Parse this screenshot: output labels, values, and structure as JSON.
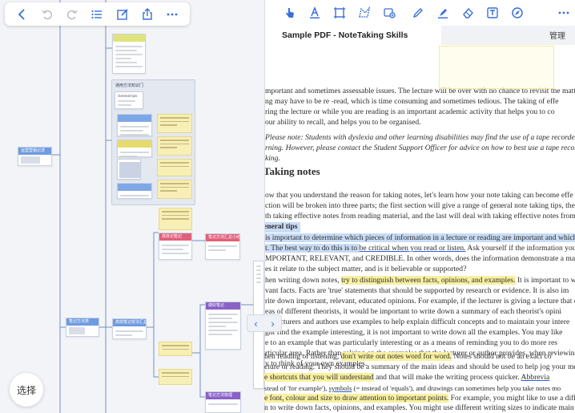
{
  "left_toolbar": {
    "buttons": [
      "back-icon",
      "undo-icon",
      "redo-icon",
      "list-icon",
      "edit-icon",
      "share-icon",
      "more-icon"
    ]
  },
  "canvas": {
    "nodes": {
      "root": "运营营销记述",
      "group_title": "通用方法知识门",
      "group_sub": "General tips",
      "middle_a": "笔记方法类",
      "middle_b": "高效笔记技法汇总",
      "pink_a": "高效记笔记",
      "pink_b": "笔记方法汇总小结",
      "purple_a": "做好笔记",
      "purple_b": "笔记方法梳理"
    }
  },
  "select_button": "选择",
  "viewer": {
    "tools": [
      "pointer-icon",
      "text-style-icon",
      "frame-icon",
      "lasso-icon",
      "image-icon",
      "pen-icon",
      "highlighter-icon",
      "eraser-icon",
      "textbox-icon",
      "compass-icon",
      "more-icon"
    ],
    "tab_title": "Sample PDF - NoteTaking Skills",
    "manage_label": "管理",
    "document": {
      "p1": [
        "mportant and sometimes assessable issues. The lecture will be over with no chance to revisit the matter",
        "ng may have to be re -read, which is time consuming and sometimes tedious. The taking of effe",
        "ring the lecture or while you are reading is an important academic activity that helps you to co",
        "our ability to recall, and helps you to be organised."
      ],
      "p2": [
        "Please note: Students with dyslexia and other learning disabilities may find the use of a tape recorder b",
        "rning. However, please contact the Student Support Officer for advice on how to best use a tape recorder in addit",
        "king."
      ],
      "heading": "Taking notes",
      "p3": [
        "ow that you understand the reason for taking notes, let's learn how your note taking can become effe",
        "ction will be broken into three parts; the first section will give a range of general note taking tips, the nex",
        "th taking effective notes from reading material, and the last will deal with taking effective notes from le"
      ],
      "subheading": "eneral tips",
      "p4_a": "is important to determine which pieces of information in a lecture or reading are important and which",
      "p4_b1": "t. The best way to do this is to ",
      "p4_b2": "be critical when you read or listen.",
      "p4_b3": " Ask yourself if the information you're l",
      "p4_c": "MPORTANT, RELEVANT, and CREDIBLE. In other words, does the information demonstrate a ma",
      "p4_d": "es it relate to the subject matter, and is it believable or supported?",
      "p5_a1": "hen writing down notes, ",
      "p5_a2": "try to distinguish between facts, opinions, and examples.",
      "p5_a3": " It is important to w",
      "p5": [
        "vant facts. Facts are 'true' statements that should be supported by research or evidence. It is also im",
        "rite down important, relevant, educated opinions. For example, if the lecturer is giving a lecture that  com",
        "eas of different theorists, it would be important to write down a summary of each theorist's opini",
        "s. Lecturers and authors use examples to help explain difficult concepts and to maintain your intere",
        "ght find the example interesting, it is not important to write down all the examples. You may like",
        "e to an example that was particularly interesting or as a means of reminding you to do more res",
        "rticular area. Rather than relying on the examples that the lecturer or author provides, when reviewing y",
        "y to think of your own examples."
      ],
      "p6_a1": "hen reading or listening, ",
      "p6_a2": "don't write out notes word for word.",
      "p6_a3": " Notes should not be an exact co",
      "p6_b": "cture or reading. They should be a summary of the main ideas and should be used to help jog your memory.",
      "p7_a1": "e shortcuts that you will understand",
      "p7_a2": " and that will make the writing process quicker. ",
      "p7_a3": "Abbrevia",
      "p7_b1": "stead of 'for example'), ",
      "p7_b2": "symbols",
      "p7_b3": " (= instead of 'equals'), and drawings can sometimes help you take notes mo",
      "p8_a1": "e font, colour and size to draw attention to important points.",
      "p8_a2": " For example, you might like to use a differ",
      "p8_b": "n to write down facts, opinions, and examples. You might use different writing sizes to indicate main poin"
    }
  }
}
